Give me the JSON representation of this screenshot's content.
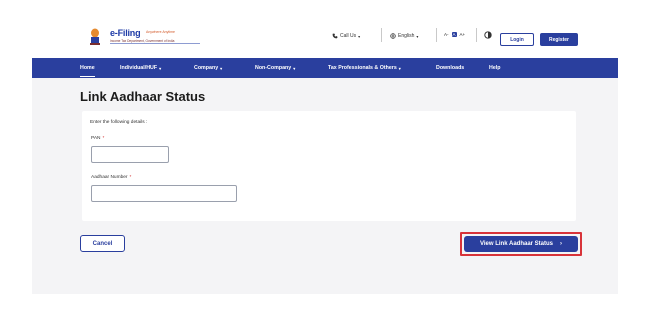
{
  "header": {
    "logo": {
      "title": "e-Filing",
      "tagline": "Anywhere Anytime",
      "subtitle": "Income Tax Department, Government of India"
    },
    "call_us": "Call Us",
    "language": "English",
    "font_controls": [
      "A-",
      "A",
      "A+"
    ],
    "login_label": "Login",
    "register_label": "Register"
  },
  "nav": {
    "items": [
      {
        "label": "Home",
        "caret": ""
      },
      {
        "label": "Individual/HUF",
        "caret": "▾"
      },
      {
        "label": "Company",
        "caret": "▾"
      },
      {
        "label": "Non-Company",
        "caret": "▾"
      },
      {
        "label": "Tax Professionals & Others",
        "caret": "▾"
      },
      {
        "label": "Downloads",
        "caret": ""
      },
      {
        "label": "Help",
        "caret": ""
      }
    ]
  },
  "main": {
    "title": "Link Aadhaar Status",
    "intro": "Enter the following details :",
    "pan": {
      "label": "PAN",
      "required": "*",
      "value": "",
      "placeholder": ""
    },
    "aadhaar": {
      "label": "Aadhaar Number",
      "required": "*",
      "value": "",
      "placeholder": ""
    }
  },
  "actions": {
    "cancel_label": "Cancel",
    "submit_label": "View Link Aadhaar Status",
    "submit_arrow": "›"
  },
  "colors": {
    "brand_blue": "#2a3f9e",
    "highlight_red": "#d8333a",
    "background": "#f4f4f6"
  }
}
